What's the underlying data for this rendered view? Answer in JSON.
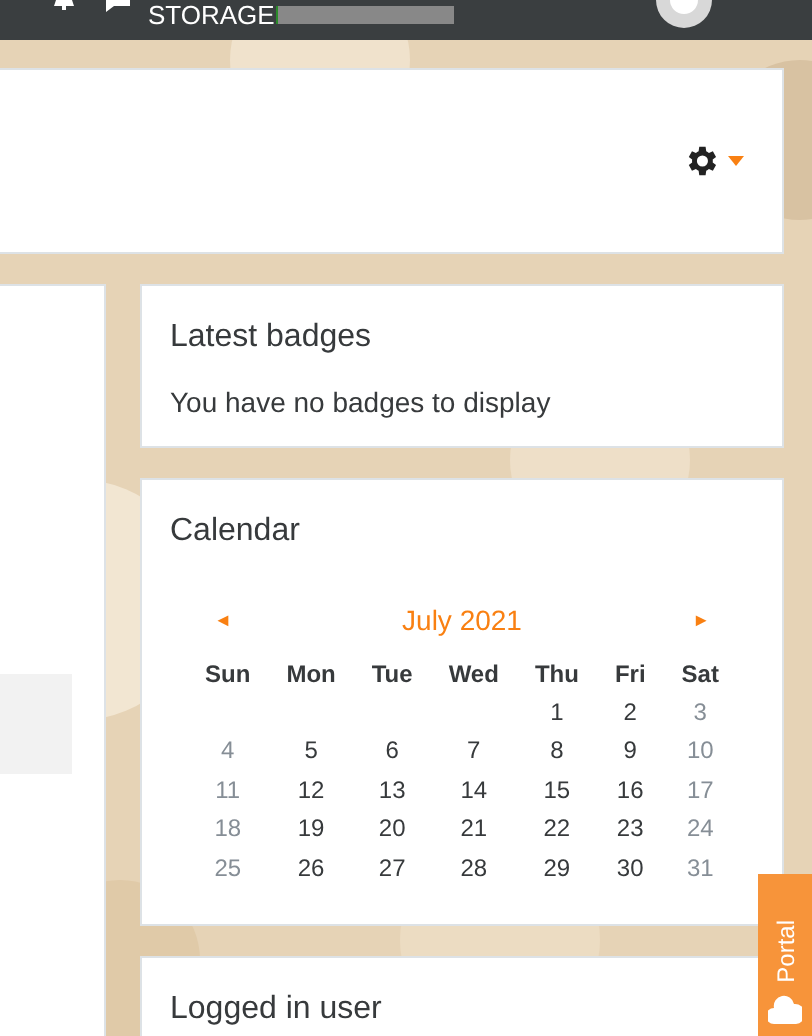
{
  "top_bar": {
    "storage_label": "STORAGE"
  },
  "badges_block": {
    "title": "Latest badges",
    "message": "You have no badges to display"
  },
  "calendar_block": {
    "title": "Calendar",
    "month": "July 2021",
    "prev": "◄",
    "next": "►",
    "weekdays": [
      "Sun",
      "Mon",
      "Tue",
      "Wed",
      "Thu",
      "Fri",
      "Sat"
    ],
    "weeks": [
      [
        {
          "day": "1",
          "weekend": false
        },
        {
          "day": "2",
          "weekend": false
        },
        {
          "day": "3",
          "weekend": true
        }
      ],
      [
        {
          "day": "4",
          "weekend": true
        },
        {
          "day": "5",
          "weekend": false
        },
        {
          "day": "6",
          "weekend": false
        },
        {
          "day": "7",
          "weekend": false
        },
        {
          "day": "8",
          "weekend": false
        },
        {
          "day": "9",
          "weekend": false
        },
        {
          "day": "10",
          "weekend": true
        }
      ],
      [
        {
          "day": "11",
          "weekend": true
        },
        {
          "day": "12",
          "weekend": false
        },
        {
          "day": "13",
          "weekend": false
        },
        {
          "day": "14",
          "weekend": false
        },
        {
          "day": "15",
          "weekend": false
        },
        {
          "day": "16",
          "weekend": false
        },
        {
          "day": "17",
          "weekend": true
        }
      ],
      [
        {
          "day": "18",
          "weekend": true
        },
        {
          "day": "19",
          "weekend": false
        },
        {
          "day": "20",
          "weekend": false
        },
        {
          "day": "21",
          "weekend": false
        },
        {
          "day": "22",
          "weekend": false
        },
        {
          "day": "23",
          "weekend": false
        },
        {
          "day": "24",
          "weekend": true
        }
      ],
      [
        {
          "day": "25",
          "weekend": true
        },
        {
          "day": "26",
          "weekend": false
        },
        {
          "day": "27",
          "weekend": false
        },
        {
          "day": "28",
          "weekend": false
        },
        {
          "day": "29",
          "weekend": false
        },
        {
          "day": "30",
          "weekend": false
        },
        {
          "day": "31",
          "weekend": true
        }
      ]
    ]
  },
  "user_block": {
    "title": "Logged in user"
  },
  "portal_tab": {
    "label": "Portal"
  }
}
